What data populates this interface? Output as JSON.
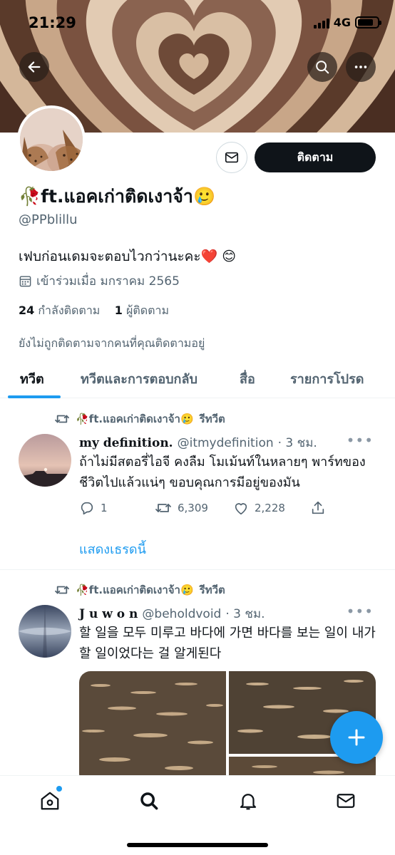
{
  "status_bar": {
    "time": "21:29",
    "network": "4G"
  },
  "profile": {
    "display_name": "🥀ft.แอคเก่าติดเงาจ้า🥲",
    "handle": "@PPblillu",
    "bio": "เฟบก่อนเดมจะตอบไวกว่านะคะ❤️ 😊",
    "joined": "เข้าร่วมเมื่อ มกราคม 2565",
    "following_count": "24",
    "following_label": "กำลังติดตาม",
    "followers_count": "1",
    "followers_label": "ผู้ติดตาม",
    "not_followed_note": "ยังไม่ถูกติดตามจากคนที่คุณติดตามอยู่",
    "follow_button": "ติดตาม"
  },
  "tabs": [
    "ทวีต",
    "ทวีตและการตอบกลับ",
    "สื่อ",
    "รายการโปรด"
  ],
  "tweets": [
    {
      "retweeted_by": "🥀ft.แอคเก่าติดเงาจ้า🥲",
      "retweet_label": "รีทวีต",
      "name": "my definition.",
      "handle": "@itmydefinition",
      "time": "· 3 ชม.",
      "text": "ถ้าไม่มีสตอรี่ไอจี คงลืม โมเม้นท์ในหลายๆ พาร์ทของชีวิตไปแล้วแน่ๆ ขอบคุณการมีอยู่ของมัน",
      "replies": "1",
      "retweets": "6,309",
      "likes": "2,228",
      "show_thread": "แสดงเธรดนี้"
    },
    {
      "retweeted_by": "🥀ft.แอคเก่าติดเงาจ้า🥲",
      "retweet_label": "รีทวีต",
      "name": "J u w o n",
      "handle": "@beholdvoid",
      "time": "· 3 ชม.",
      "text": "할 일을 모두 미루고 바다에 가면 바다를 보는 일이 내가 할 일이었다는 걸 알게된다"
    }
  ],
  "colors": {
    "accent": "#1d9bf0",
    "text": "#0f1419",
    "secondary": "#536471"
  },
  "icons": {
    "back": "arrow-left-icon",
    "search": "search-icon",
    "more": "more-icon",
    "mail": "mail-icon",
    "calendar": "calendar-icon",
    "retweet": "retweet-icon",
    "reply": "reply-icon",
    "like": "heart-icon",
    "share": "share-icon",
    "compose": "plus-icon",
    "home": "home-icon",
    "notifications": "bell-icon",
    "messages": "envelope-icon"
  }
}
